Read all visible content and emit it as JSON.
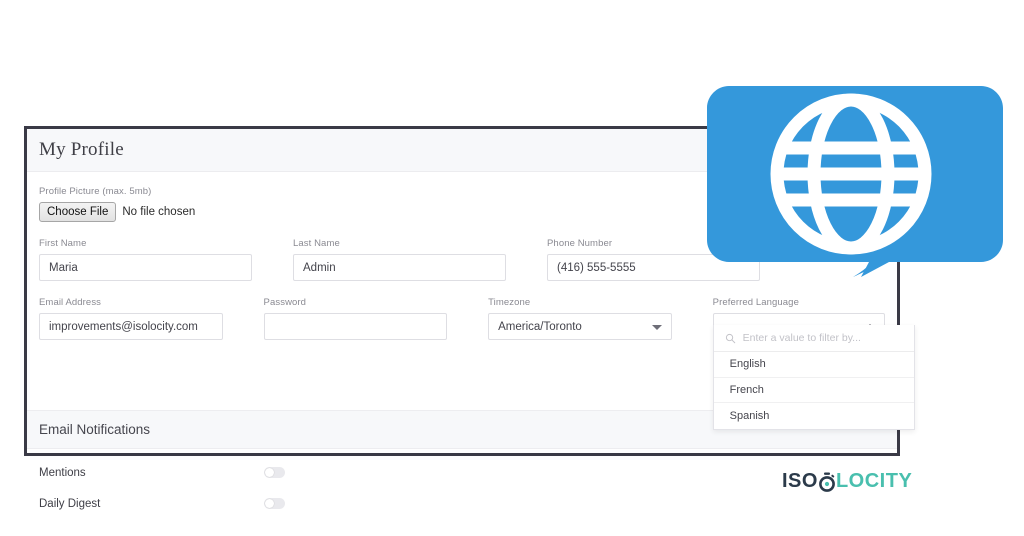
{
  "panel": {
    "header_title": "My Profile"
  },
  "profile_picture": {
    "label": "Profile Picture (max. 5mb)",
    "button_label": "Choose File",
    "file_status": "No file chosen"
  },
  "form": {
    "row1": [
      {
        "label": "First Name",
        "value": "Maria",
        "type": "text"
      },
      {
        "label": "Last Name",
        "value": "Admin",
        "type": "text"
      },
      {
        "label": "Phone Number",
        "value": "(416) 555-5555",
        "type": "text"
      }
    ],
    "row2": [
      {
        "label": "Email Address",
        "value": "improvements@isolocity.com",
        "type": "text"
      },
      {
        "label": "Password",
        "value": "",
        "type": "password"
      },
      {
        "label": "Timezone",
        "value": "America/Toronto",
        "type": "select"
      },
      {
        "label": "Preferred Language",
        "value": "",
        "type": "select"
      }
    ]
  },
  "language_dropdown": {
    "filter_placeholder": "Enter a value to filter by...",
    "search_icon": "search-icon",
    "caret_icon": "chevron-up-icon",
    "options": [
      "English",
      "French",
      "Spanish"
    ]
  },
  "timezone_dropdown": {
    "caret_icon": "chevron-down-icon"
  },
  "notifications": {
    "section_title": "Email Notifications",
    "rows": [
      {
        "label": "Mentions",
        "enabled": false
      },
      {
        "label": "Daily Digest",
        "enabled": false
      }
    ]
  },
  "overlay_icon": {
    "name": "globe-speech-bubble-icon",
    "bubble_color": "#3498db",
    "globe_color": "#ffffff"
  },
  "logo": {
    "part1": "ISO",
    "part2": "LOCITY",
    "mark": "stopwatch-icon",
    "color1": "#2b3a4a",
    "color2": "#49bfae"
  }
}
